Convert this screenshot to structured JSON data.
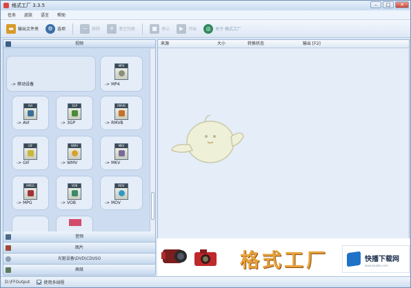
{
  "window": {
    "title": "格式工厂 3.3.5"
  },
  "menu": [
    "任务",
    "皮肤",
    "语言",
    "帮助"
  ],
  "toolbar": {
    "items": [
      {
        "label": "输出文件夹",
        "icon": "folder-icon",
        "color": "#d89a2a",
        "enabled": true
      },
      {
        "label": "选项",
        "icon": "options-icon",
        "color": "#3a6fa8",
        "enabled": true
      },
      {
        "label": "移除",
        "icon": "minus-icon",
        "color": "#7f8fa3",
        "enabled": false
      },
      {
        "label": "清空列表",
        "icon": "clear-icon",
        "color": "#7f8fa3",
        "enabled": false
      },
      {
        "label": "停止",
        "icon": "stop-icon",
        "color": "#7f8fa3",
        "enabled": false
      },
      {
        "label": "开始",
        "icon": "start-icon",
        "color": "#7f8fa3",
        "enabled": false
      },
      {
        "label": "关于 格式工厂",
        "icon": "about-icon",
        "color": "#2f8a5e",
        "enabled": true
      }
    ]
  },
  "left": {
    "video_header": "视频",
    "tiles": [
      {
        "label": "-> 移动设备",
        "tag": "",
        "color": ""
      },
      {
        "label": "-> MP4",
        "tag": "MP4",
        "color": "#8a8f7a"
      },
      {
        "label": "-> AVI",
        "tag": "AVI",
        "color": "#3a6f9a"
      },
      {
        "label": "-> 3GP",
        "tag": "3GP",
        "color": "#4a8a3a"
      },
      {
        "label": "-> RMVB",
        "tag": "RMVB",
        "color": "#c8712a"
      },
      {
        "label": "-> GIF",
        "tag": "GIF",
        "color": "#c9b83a"
      },
      {
        "label": "-> WMV",
        "tag": "WMV",
        "color": "#d9a12a"
      },
      {
        "label": "-> MKV",
        "tag": "MKV",
        "color": "#7a6a9a"
      },
      {
        "label": "-> MPG",
        "tag": "MPEG",
        "color": "#a0323a"
      },
      {
        "label": "-> VOB",
        "tag": "VOB",
        "color": "#3a8a6a"
      },
      {
        "label": "-> MOV",
        "tag": "MOV",
        "color": "#2f9ac8"
      }
    ],
    "categories": [
      "音频",
      "图片",
      "光驱设备\\DVD\\CD\\ISO",
      "高级"
    ]
  },
  "columns": [
    "来源",
    "大小",
    "转换状态",
    "输出 [F2]"
  ],
  "status": {
    "path": "D:\\FFOutput",
    "multithread_label": "使用多线程",
    "multithread_checked": true
  },
  "banner": {
    "logo_text": "格式工厂",
    "brand_name": "快播下载网",
    "brand_url": "www.kuaibo.com"
  }
}
